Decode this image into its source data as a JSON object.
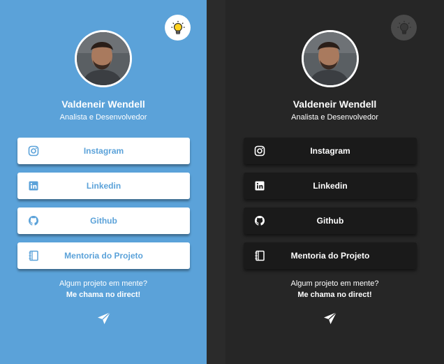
{
  "profile": {
    "name": "Valdeneir Wendell",
    "role": "Analista e Desenvolvedor"
  },
  "links": [
    {
      "label": "Instagram",
      "icon": "instagram-icon"
    },
    {
      "label": "Linkedin",
      "icon": "linkedin-icon"
    },
    {
      "label": "Github",
      "icon": "github-icon"
    },
    {
      "label": "Mentoria do Projeto",
      "icon": "notebook-icon"
    }
  ],
  "cta": {
    "line1": "Algum projeto em mente?",
    "line2": "Me chama no direct!"
  },
  "theme": {
    "light_bg": "#5ba2d9",
    "dark_bg": "#262626",
    "toggle_light": "lightbulb-on-icon",
    "toggle_dark": "lightbulb-off-icon"
  }
}
